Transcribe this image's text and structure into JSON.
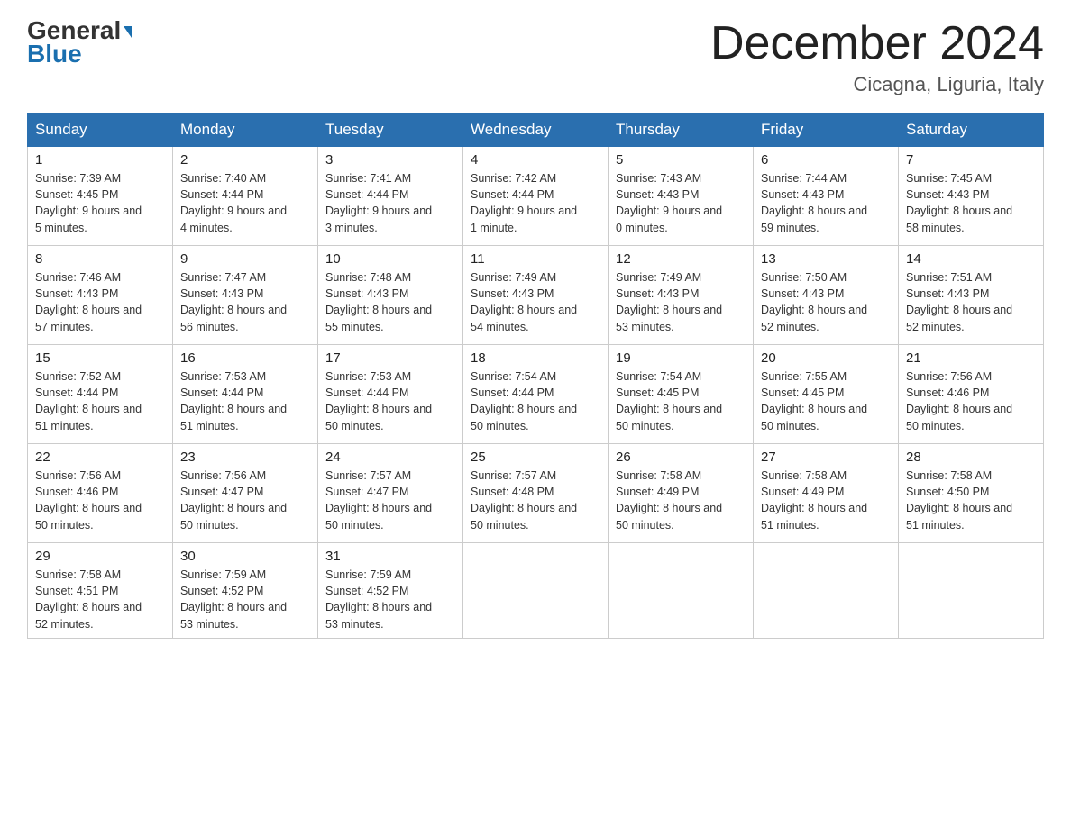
{
  "logo": {
    "general": "General",
    "triangle": "▶",
    "blue": "Blue"
  },
  "header": {
    "title": "December 2024",
    "location": "Cicagna, Liguria, Italy"
  },
  "days_of_week": [
    "Sunday",
    "Monday",
    "Tuesday",
    "Wednesday",
    "Thursday",
    "Friday",
    "Saturday"
  ],
  "weeks": [
    [
      {
        "day": "1",
        "sunrise": "7:39 AM",
        "sunset": "4:45 PM",
        "daylight": "9 hours and 5 minutes."
      },
      {
        "day": "2",
        "sunrise": "7:40 AM",
        "sunset": "4:44 PM",
        "daylight": "9 hours and 4 minutes."
      },
      {
        "day": "3",
        "sunrise": "7:41 AM",
        "sunset": "4:44 PM",
        "daylight": "9 hours and 3 minutes."
      },
      {
        "day": "4",
        "sunrise": "7:42 AM",
        "sunset": "4:44 PM",
        "daylight": "9 hours and 1 minute."
      },
      {
        "day": "5",
        "sunrise": "7:43 AM",
        "sunset": "4:43 PM",
        "daylight": "9 hours and 0 minutes."
      },
      {
        "day": "6",
        "sunrise": "7:44 AM",
        "sunset": "4:43 PM",
        "daylight": "8 hours and 59 minutes."
      },
      {
        "day": "7",
        "sunrise": "7:45 AM",
        "sunset": "4:43 PM",
        "daylight": "8 hours and 58 minutes."
      }
    ],
    [
      {
        "day": "8",
        "sunrise": "7:46 AM",
        "sunset": "4:43 PM",
        "daylight": "8 hours and 57 minutes."
      },
      {
        "day": "9",
        "sunrise": "7:47 AM",
        "sunset": "4:43 PM",
        "daylight": "8 hours and 56 minutes."
      },
      {
        "day": "10",
        "sunrise": "7:48 AM",
        "sunset": "4:43 PM",
        "daylight": "8 hours and 55 minutes."
      },
      {
        "day": "11",
        "sunrise": "7:49 AM",
        "sunset": "4:43 PM",
        "daylight": "8 hours and 54 minutes."
      },
      {
        "day": "12",
        "sunrise": "7:49 AM",
        "sunset": "4:43 PM",
        "daylight": "8 hours and 53 minutes."
      },
      {
        "day": "13",
        "sunrise": "7:50 AM",
        "sunset": "4:43 PM",
        "daylight": "8 hours and 52 minutes."
      },
      {
        "day": "14",
        "sunrise": "7:51 AM",
        "sunset": "4:43 PM",
        "daylight": "8 hours and 52 minutes."
      }
    ],
    [
      {
        "day": "15",
        "sunrise": "7:52 AM",
        "sunset": "4:44 PM",
        "daylight": "8 hours and 51 minutes."
      },
      {
        "day": "16",
        "sunrise": "7:53 AM",
        "sunset": "4:44 PM",
        "daylight": "8 hours and 51 minutes."
      },
      {
        "day": "17",
        "sunrise": "7:53 AM",
        "sunset": "4:44 PM",
        "daylight": "8 hours and 50 minutes."
      },
      {
        "day": "18",
        "sunrise": "7:54 AM",
        "sunset": "4:44 PM",
        "daylight": "8 hours and 50 minutes."
      },
      {
        "day": "19",
        "sunrise": "7:54 AM",
        "sunset": "4:45 PM",
        "daylight": "8 hours and 50 minutes."
      },
      {
        "day": "20",
        "sunrise": "7:55 AM",
        "sunset": "4:45 PM",
        "daylight": "8 hours and 50 minutes."
      },
      {
        "day": "21",
        "sunrise": "7:56 AM",
        "sunset": "4:46 PM",
        "daylight": "8 hours and 50 minutes."
      }
    ],
    [
      {
        "day": "22",
        "sunrise": "7:56 AM",
        "sunset": "4:46 PM",
        "daylight": "8 hours and 50 minutes."
      },
      {
        "day": "23",
        "sunrise": "7:56 AM",
        "sunset": "4:47 PM",
        "daylight": "8 hours and 50 minutes."
      },
      {
        "day": "24",
        "sunrise": "7:57 AM",
        "sunset": "4:47 PM",
        "daylight": "8 hours and 50 minutes."
      },
      {
        "day": "25",
        "sunrise": "7:57 AM",
        "sunset": "4:48 PM",
        "daylight": "8 hours and 50 minutes."
      },
      {
        "day": "26",
        "sunrise": "7:58 AM",
        "sunset": "4:49 PM",
        "daylight": "8 hours and 50 minutes."
      },
      {
        "day": "27",
        "sunrise": "7:58 AM",
        "sunset": "4:49 PM",
        "daylight": "8 hours and 51 minutes."
      },
      {
        "day": "28",
        "sunrise": "7:58 AM",
        "sunset": "4:50 PM",
        "daylight": "8 hours and 51 minutes."
      }
    ],
    [
      {
        "day": "29",
        "sunrise": "7:58 AM",
        "sunset": "4:51 PM",
        "daylight": "8 hours and 52 minutes."
      },
      {
        "day": "30",
        "sunrise": "7:59 AM",
        "sunset": "4:52 PM",
        "daylight": "8 hours and 53 minutes."
      },
      {
        "day": "31",
        "sunrise": "7:59 AM",
        "sunset": "4:52 PM",
        "daylight": "8 hours and 53 minutes."
      },
      null,
      null,
      null,
      null
    ]
  ]
}
